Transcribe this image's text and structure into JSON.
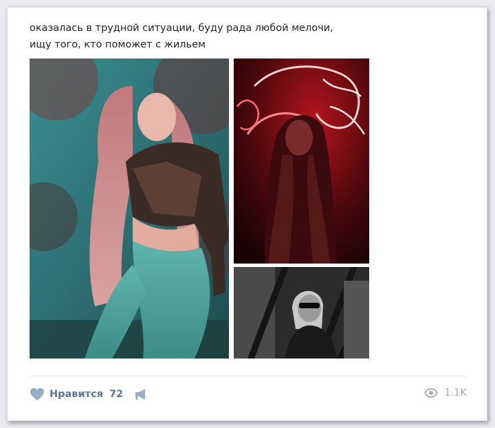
{
  "post": {
    "text_lines": [
      "оказалась в трудной ситуации, буду рада любой мелочи,",
      "ищу того, кто поможет с жильем"
    ]
  },
  "photos": [
    {
      "id": "photo-1",
      "icon": "photo-teal-portrait"
    },
    {
      "id": "photo-2",
      "icon": "photo-red-neon"
    },
    {
      "id": "photo-3",
      "icon": "photo-bw-sunglasses"
    }
  ],
  "actions": {
    "like_label": "Нравится",
    "like_count": "72",
    "views_count": "1.1K",
    "icons": [
      "heart-icon",
      "megaphone-icon",
      "eye-icon"
    ]
  },
  "colors": {
    "accent": "#5b7699",
    "icon": "#99aec8",
    "muted": "#a0a9b4"
  }
}
